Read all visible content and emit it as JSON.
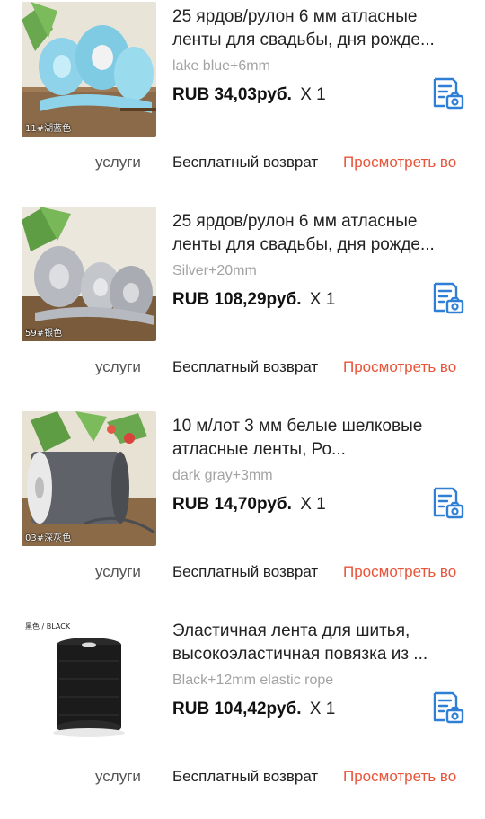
{
  "items": [
    {
      "title": "25 ярдов/рулон 6 мм атласные ленты для свадьбы, дня рожде...",
      "variant": "lake blue+6mm",
      "price": "RUB 34,03руб.",
      "quantity": "X 1",
      "image_caption": "11#湖蓝色",
      "image_subject": "light blue satin ribbon rolls",
      "services_label": "услуги",
      "free_return_label": "Бесплатный возврат",
      "view_label": "Просмотреть во"
    },
    {
      "title": "25 ярдов/рулон 6 мм атласные ленты для свадьбы, дня рожде...",
      "variant": "Silver+20mm",
      "price": "RUB 108,29руб.",
      "quantity": "X 1",
      "image_caption": "59#银色",
      "image_subject": "silver satin ribbon rolls",
      "services_label": "услуги",
      "free_return_label": "Бесплатный возврат",
      "view_label": "Просмотреть во"
    },
    {
      "title": "10 м/лот 3 мм белые шелковые атласные ленты, Ро...",
      "variant": "dark gray+3mm",
      "price": "RUB 14,70руб.",
      "quantity": "X 1",
      "image_caption": "03#深灰色",
      "image_subject": "dark gray thin satin ribbon spool",
      "services_label": "услуги",
      "free_return_label": "Бесплатный возврат",
      "view_label": "Просмотреть во"
    },
    {
      "title": "Эластичная лента для шитья, высокоэластичная повязка из ...",
      "variant": "Black+12mm elastic rope",
      "price": "RUB 104,42руб.",
      "quantity": "X 1",
      "image_caption": "黑色 / BLACK",
      "image_subject": "black elastic band spool",
      "services_label": "услуги",
      "free_return_label": "Бесплатный возврат",
      "view_label": "Просмотреть во"
    }
  ],
  "icons": {
    "invoice": "invoice-camera-icon"
  },
  "colors": {
    "accent_link": "#e8553a",
    "icon_blue": "#2f7fd6",
    "variant_gray": "#a3a3a3",
    "background": "#ffffff"
  }
}
